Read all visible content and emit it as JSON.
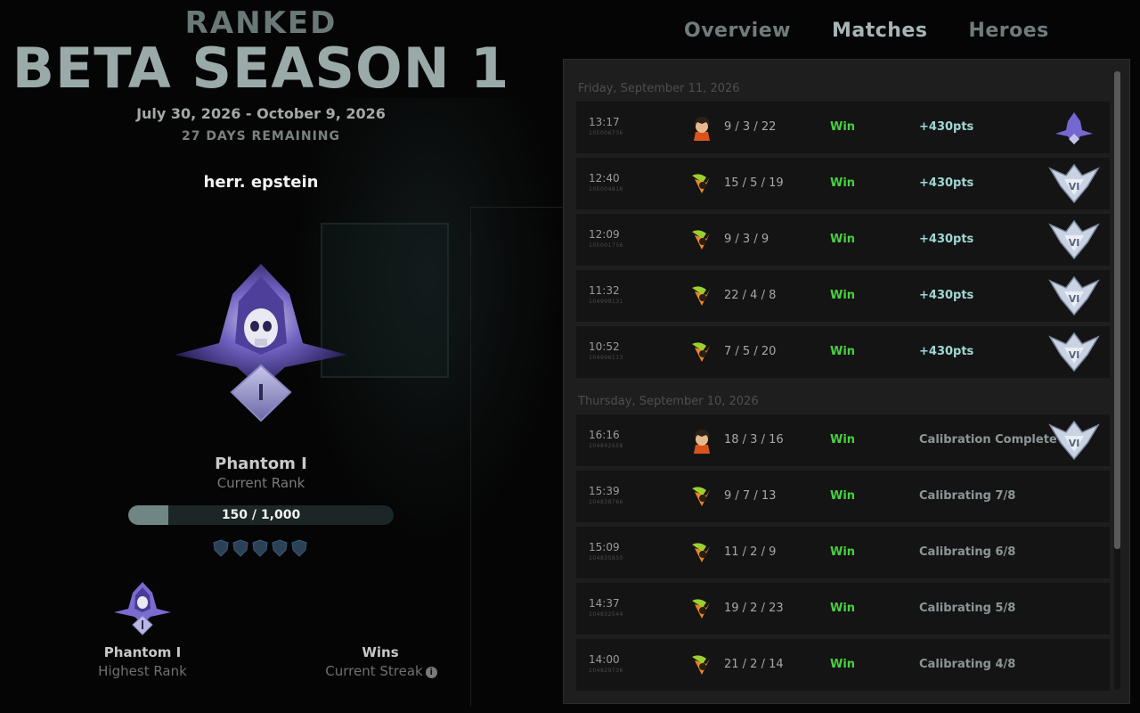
{
  "header": {
    "ranked_label": "RANKED",
    "season_title": "BETA SEASON 1",
    "season_dates": "July 30, 2026 - October 9, 2026",
    "days_remaining": "27 DAYS REMAINING"
  },
  "player": {
    "name": "herr. epstein"
  },
  "current_rank": {
    "name": "Phantom I",
    "label": "Current Rank",
    "progress_text": "150 / 1,000",
    "progress_value": 150,
    "progress_max": 1000,
    "pips": 5
  },
  "highest_rank": {
    "name": "Phantom I",
    "label": "Highest Rank"
  },
  "streak": {
    "value": "Wins",
    "label": "Current Streak",
    "info_glyph": "i"
  },
  "tabs": [
    {
      "label": "Overview",
      "active": false
    },
    {
      "label": "Matches",
      "active": true
    },
    {
      "label": "Heroes",
      "active": false
    }
  ],
  "colors": {
    "win": "#47d13f",
    "pts_gain": "#9fd7d4",
    "calibration": "#8d9697",
    "progress_fill": "#6f8684"
  },
  "match_days": [
    {
      "date": "Friday, September 11, 2026",
      "matches": [
        {
          "time": "13:17",
          "match_id": "105006736",
          "hero": "hero-portrait-human",
          "kda": "9 / 3 / 22",
          "result": "Win",
          "points": "+430pts",
          "rank_icon": "phantom-small"
        },
        {
          "time": "12:40",
          "match_id": "105004816",
          "hero": "hero-portrait-green",
          "kda": "15 / 5 / 19",
          "result": "Win",
          "points": "+430pts",
          "rank_icon": "silver-vi"
        },
        {
          "time": "12:09",
          "match_id": "105001756",
          "hero": "hero-portrait-green",
          "kda": "9 / 3 / 9",
          "result": "Win",
          "points": "+430pts",
          "rank_icon": "silver-vi"
        },
        {
          "time": "11:32",
          "match_id": "104999131",
          "hero": "hero-portrait-green",
          "kda": "22 / 4 / 8",
          "result": "Win",
          "points": "+430pts",
          "rank_icon": "silver-vi"
        },
        {
          "time": "10:52",
          "match_id": "104996113",
          "hero": "hero-portrait-green",
          "kda": "7 / 5 / 20",
          "result": "Win",
          "points": "+430pts",
          "rank_icon": "silver-vi"
        }
      ]
    },
    {
      "date": "Thursday, September 10, 2026",
      "matches": [
        {
          "time": "16:16",
          "match_id": "104842658",
          "hero": "hero-portrait-human",
          "kda": "18 / 3 / 16",
          "result": "Win",
          "points": "Calibration Complete",
          "rank_icon": "silver-vi"
        },
        {
          "time": "15:39",
          "match_id": "104838766",
          "hero": "hero-portrait-green",
          "kda": "9 / 7 / 13",
          "result": "Win",
          "points": "Calibrating 7/8",
          "rank_icon": ""
        },
        {
          "time": "15:09",
          "match_id": "104835850",
          "hero": "hero-portrait-green",
          "kda": "11 / 2 / 9",
          "result": "Win",
          "points": "Calibrating 6/8",
          "rank_icon": ""
        },
        {
          "time": "14:37",
          "match_id": "104832544",
          "hero": "hero-portrait-green",
          "kda": "19 / 2 / 23",
          "result": "Win",
          "points": "Calibrating 5/8",
          "rank_icon": ""
        },
        {
          "time": "14:00",
          "match_id": "104829736",
          "hero": "hero-portrait-green",
          "kda": "21 / 2 / 14",
          "result": "Win",
          "points": "Calibrating 4/8",
          "rank_icon": ""
        }
      ]
    }
  ]
}
